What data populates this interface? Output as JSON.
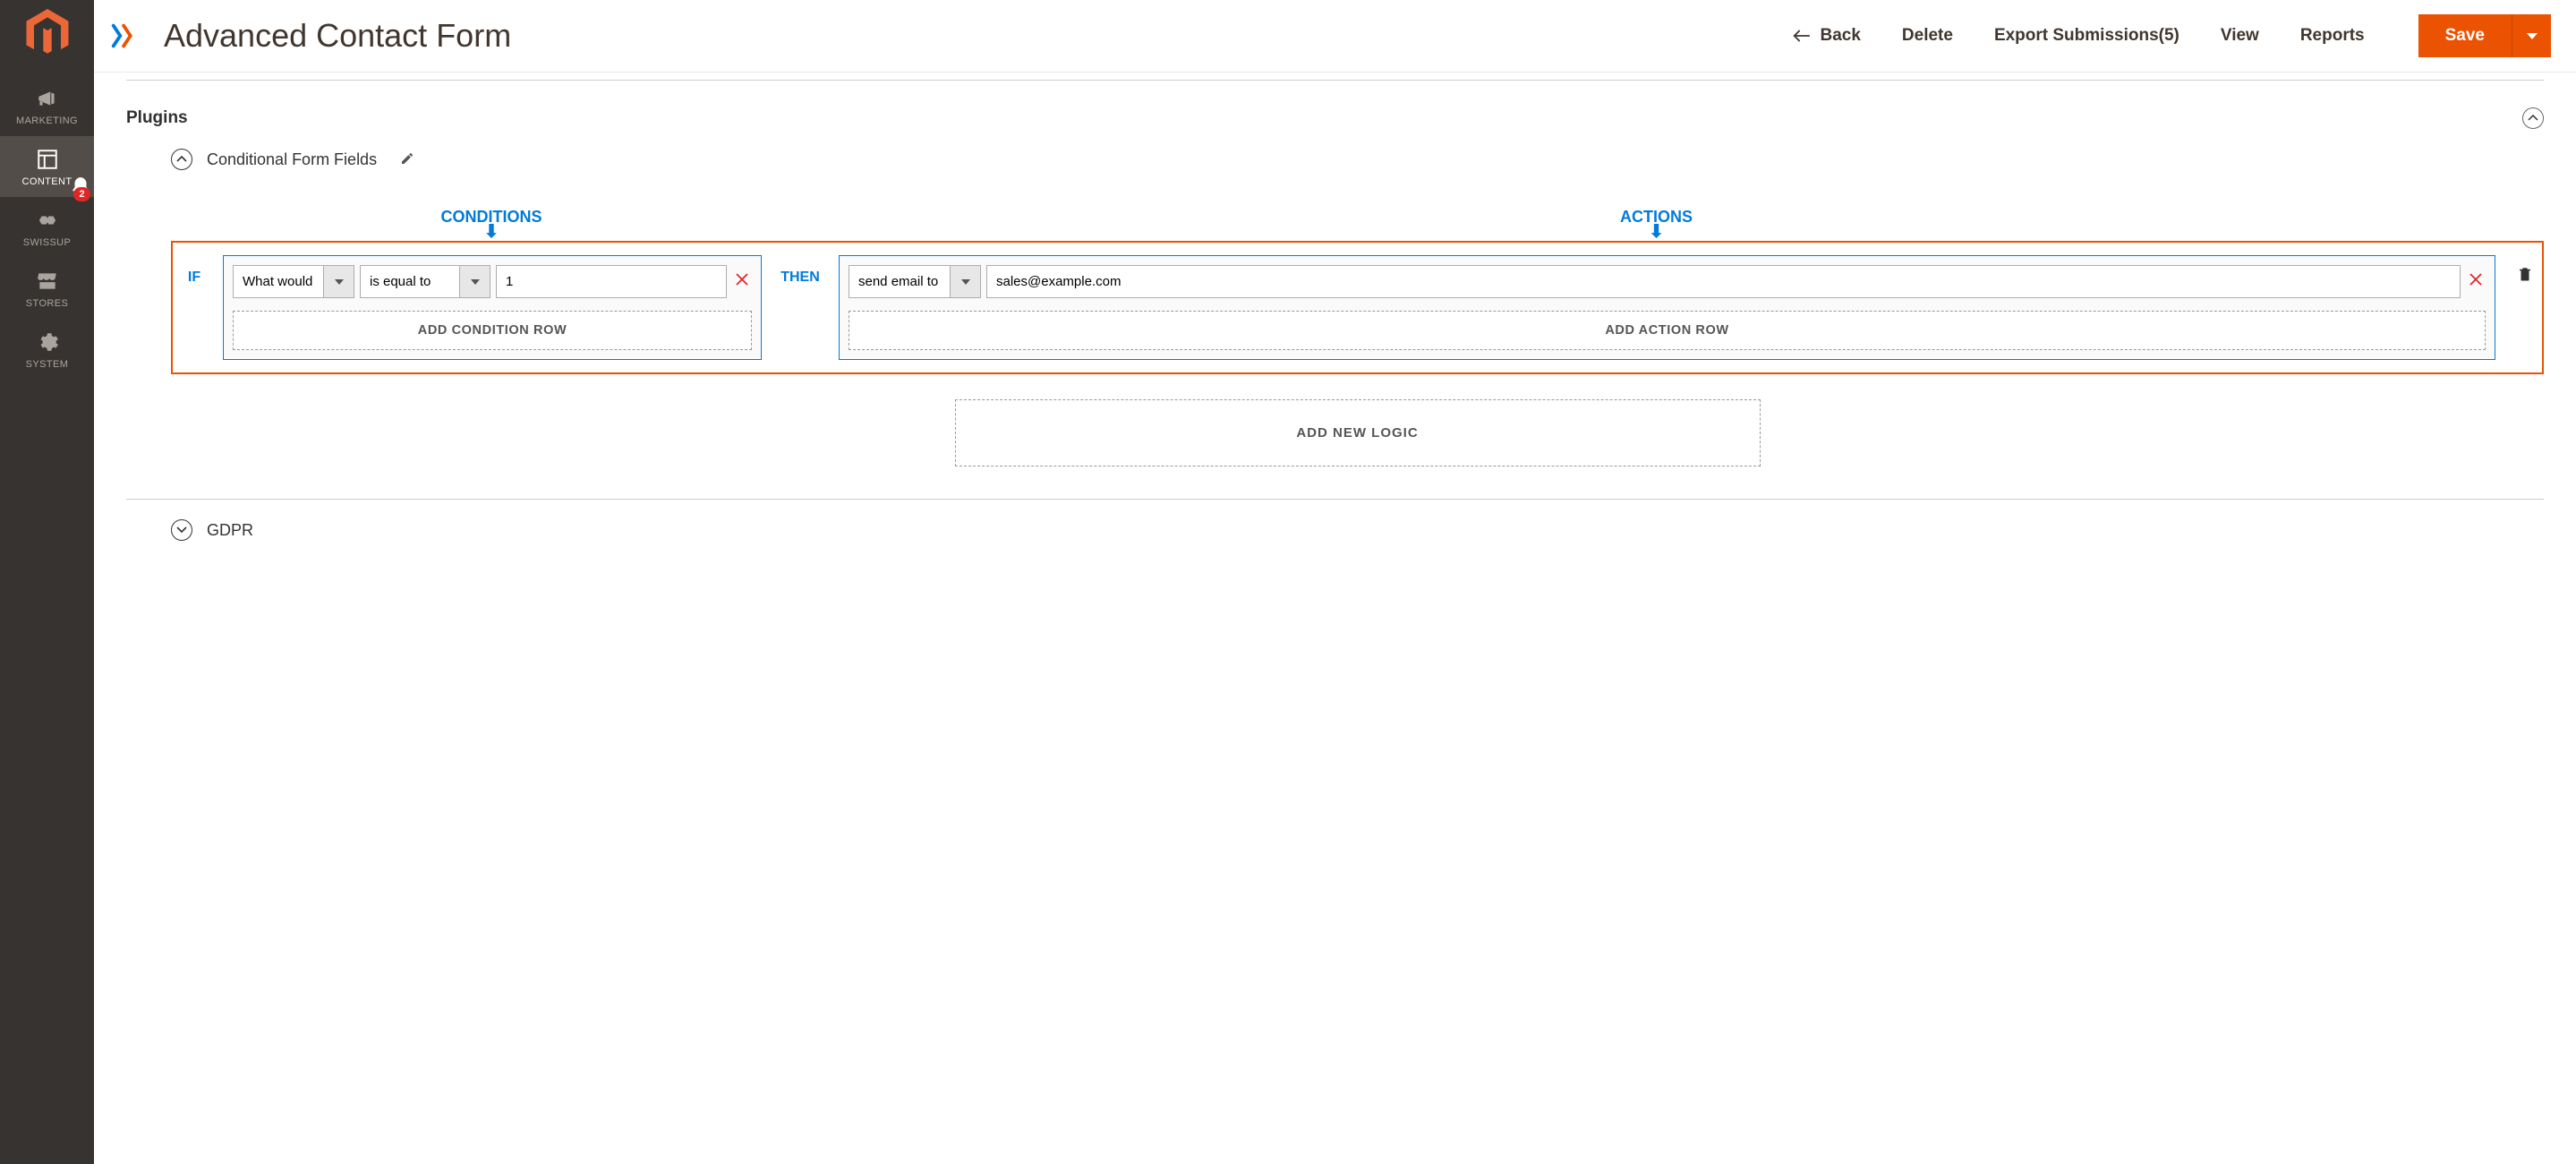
{
  "sidebar": {
    "items": [
      {
        "label": "MARKETING"
      },
      {
        "label": "CONTENT"
      },
      {
        "label": "SWISSUP"
      },
      {
        "label": "STORES"
      },
      {
        "label": "SYSTEM"
      }
    ],
    "notification_count": "2"
  },
  "header": {
    "page_title": "Advanced Contact Form",
    "back": "Back",
    "delete": "Delete",
    "export": "Export Submissions(5)",
    "view": "View",
    "reports": "Reports",
    "save": "Save"
  },
  "section": {
    "title": "Plugins",
    "sub_title": "Conditional Form Fields",
    "conditions_label": "CONDITIONS",
    "actions_label": "ACTIONS",
    "if_label": "IF",
    "then_label": "THEN",
    "condition_field": "What would",
    "condition_op": "is equal to",
    "condition_value": "1",
    "action_type": "send email to",
    "action_value": "sales@example.com",
    "add_condition": "ADD CONDITION ROW",
    "add_action": "ADD ACTION ROW",
    "add_logic": "ADD NEW LOGIC",
    "gdpr_title": "GDPR"
  }
}
